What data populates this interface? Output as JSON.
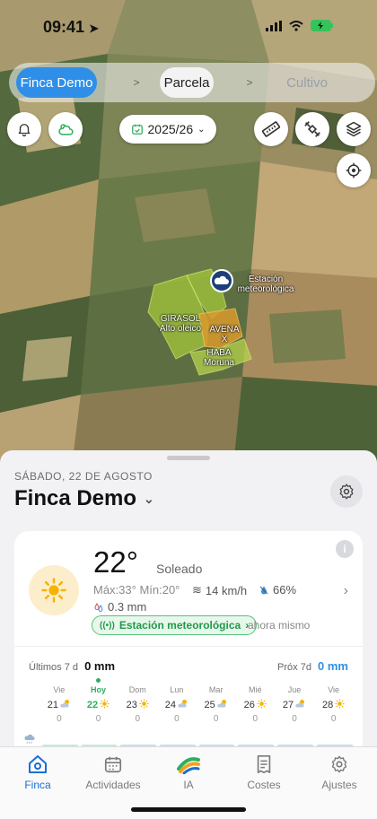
{
  "status": {
    "time": "09:41"
  },
  "breadcrumb": {
    "farm": "Finca Demo",
    "sep1": ">",
    "parcel": "Parcela",
    "sep2": ">",
    "crop": "Cultivo"
  },
  "season": {
    "label": "2025/26"
  },
  "map": {
    "station_label_1": "Estación",
    "station_label_2": "meteorológica",
    "girasol_1": "GIRASOL",
    "girasol_2": "Alto oleico",
    "avena_1": "AVENA",
    "avena_2": "X",
    "haba_1": "HABA",
    "haba_2": "Moruna"
  },
  "sheet": {
    "date": "SÁBADO, 22 DE AGOSTO",
    "farm_title": "Finca Demo"
  },
  "weather": {
    "temp": "22°",
    "condition": "Soleado",
    "minmax": "Máx:33° Mín:20°",
    "wind": "14 km/h",
    "humidity": "66%",
    "rain": "0.3 mm",
    "station": "Estación meteorológica",
    "updated": "ahora mismo",
    "info": "i"
  },
  "precip": {
    "last_label": "Últimos 7 d",
    "last_value": "0 mm",
    "next_label": "Próx 7d",
    "next_value": "0 mm",
    "unit": "mm",
    "days": [
      {
        "name": "Vie",
        "num": "21",
        "icon": "partly-cloudy-icon",
        "val": "0"
      },
      {
        "name": "Hoy",
        "num": "22",
        "icon": "sun-icon",
        "val": "0"
      },
      {
        "name": "Dom",
        "num": "23",
        "icon": "sun-icon",
        "val": "0"
      },
      {
        "name": "Lun",
        "num": "24",
        "icon": "partly-cloudy-icon",
        "val": "0"
      },
      {
        "name": "Mar",
        "num": "25",
        "icon": "partly-cloudy-icon",
        "val": "0"
      },
      {
        "name": "Mié",
        "num": "26",
        "icon": "sun-icon",
        "val": "0"
      },
      {
        "name": "Jue",
        "num": "27",
        "icon": "partly-cloudy-icon",
        "val": "0"
      },
      {
        "name": "Vie",
        "num": "28",
        "icon": "sun-icon",
        "val": "0"
      }
    ]
  },
  "tabs": [
    {
      "label": "Finca",
      "icon": "home-icon"
    },
    {
      "label": "Actividades",
      "icon": "calendar-icon"
    },
    {
      "label": "IA",
      "icon": "ai-logo-icon"
    },
    {
      "label": "Costes",
      "icon": "receipt-icon"
    },
    {
      "label": "Ajustes",
      "icon": "gear-icon"
    }
  ],
  "colors": {
    "accent": "#2f8fe8",
    "green": "#2eae62",
    "sun": "#f5b400"
  }
}
